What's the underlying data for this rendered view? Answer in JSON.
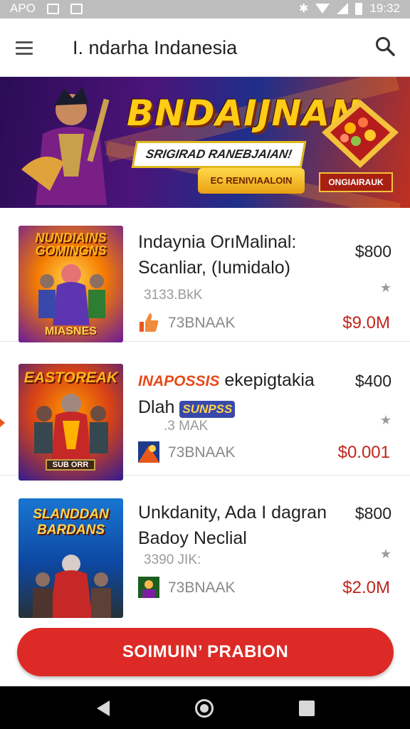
{
  "status_bar": {
    "left_text": "APO",
    "time": "19:32"
  },
  "app_bar": {
    "title": "I. ndarha Indanesia"
  },
  "banner": {
    "headline": "BNDAIJNAN",
    "subline": "SRIGIRAD RANEBJAIAN!",
    "cta_label": "EC RENIVIAALOIN",
    "food_label": "ONGIAIRAUK"
  },
  "items": [
    {
      "thumb_title": "NUNDIAINS GOMINGNS",
      "thumb_footer": "MIASNES",
      "title": "Indaynia OrıMalinal: Scanliar, (Iumidalo)",
      "price": "$800",
      "meta": "3133.BkK",
      "seller": "73BNAAK",
      "sale_price": "$9.0M",
      "thumb_colors": [
        "#f5a623",
        "#7b1fa2"
      ]
    },
    {
      "thumb_title": "EASTOREAK",
      "thumb_footer": "SUB ORR",
      "title_tag": "INAPOSSIS",
      "title": "ekepigtakia Dlah",
      "title_badge": "SUNPSS",
      "price": "$400",
      "meta": ".3 MAK",
      "seller": "73BNAAK",
      "sale_price": "$0.001",
      "thumb_colors": [
        "#e65100",
        "#4a148c"
      ]
    },
    {
      "thumb_title": "SLANDDAN BARDANS",
      "thumb_footer": "",
      "title": "Unkdanity, Ada I dagran Badoy Neclial",
      "price": "$800",
      "meta": "3390 JIK:",
      "seller": "73BNAAK",
      "sale_price": "$2.0M",
      "thumb_colors": [
        "#1565c0",
        "#0d47a1"
      ]
    }
  ],
  "primary_cta": {
    "label": "SOIMUIN’ PRABION"
  },
  "icons": {
    "menu": "hamburger-menu-icon",
    "search": "search-icon",
    "star": "star-icon",
    "back": "back-icon",
    "home": "home-icon",
    "recents": "recents-icon"
  },
  "colors": {
    "accent": "#dd2a26",
    "sale_price": "#c0261a",
    "status_bar": "#bdbdbd",
    "nav_bar": "#000000"
  }
}
